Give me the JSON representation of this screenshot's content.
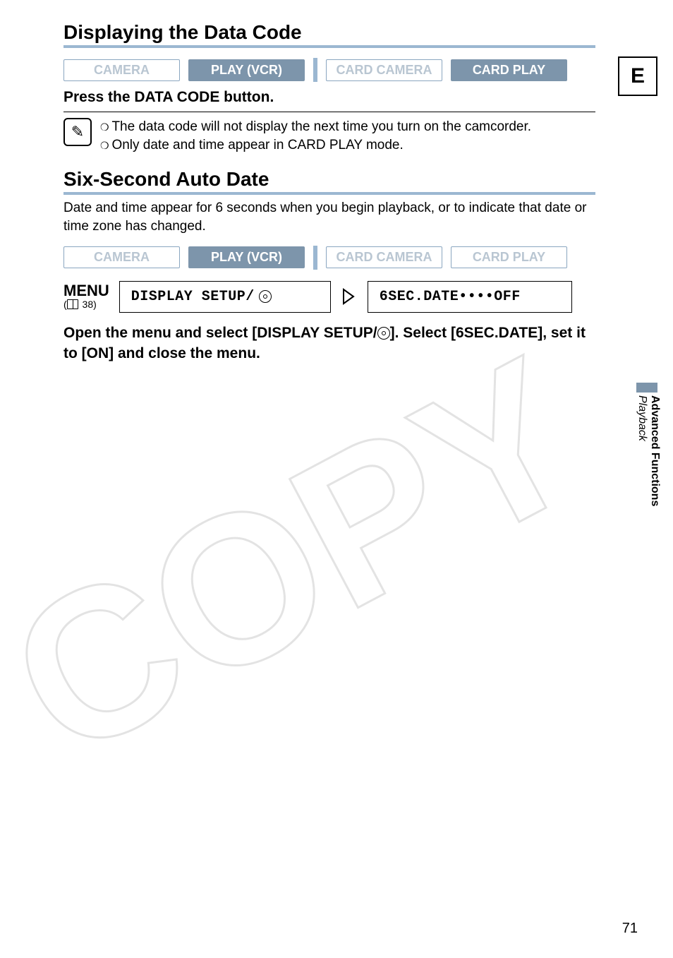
{
  "language_tab": "E",
  "page_number": "71",
  "side": {
    "section": "Advanced Functions",
    "subsection": "Playback"
  },
  "section1": {
    "title": "Displaying the Data Code",
    "modes": {
      "camera": "CAMERA",
      "play_vcr": "PLAY (VCR)",
      "card_camera": "CARD CAMERA",
      "card_play": "CARD PLAY"
    },
    "instruction": "Press the DATA CODE button.",
    "notes": {
      "n1": "The data code will not display the next time you turn on the camcorder.",
      "n2": "Only date and time appear in CARD PLAY mode."
    }
  },
  "section2": {
    "title": "Six-Second Auto Date",
    "body": "Date and time appear for 6 seconds when you begin playback, or to indicate that date or time zone has changed.",
    "modes": {
      "camera": "CAMERA",
      "play_vcr": "PLAY (VCR)",
      "card_camera": "CARD CAMERA",
      "card_play": "CARD PLAY"
    },
    "menu": {
      "head": "MENU",
      "page_ref": "38",
      "path_left": "DISPLAY SETUP/",
      "path_right": "6SEC.DATE••••OFF"
    },
    "instruction_prefix": "Open the menu and select [DISPLAY SETUP/",
    "instruction_suffix": "]. Select [6SEC.DATE], set it to [ON] and close the menu."
  }
}
